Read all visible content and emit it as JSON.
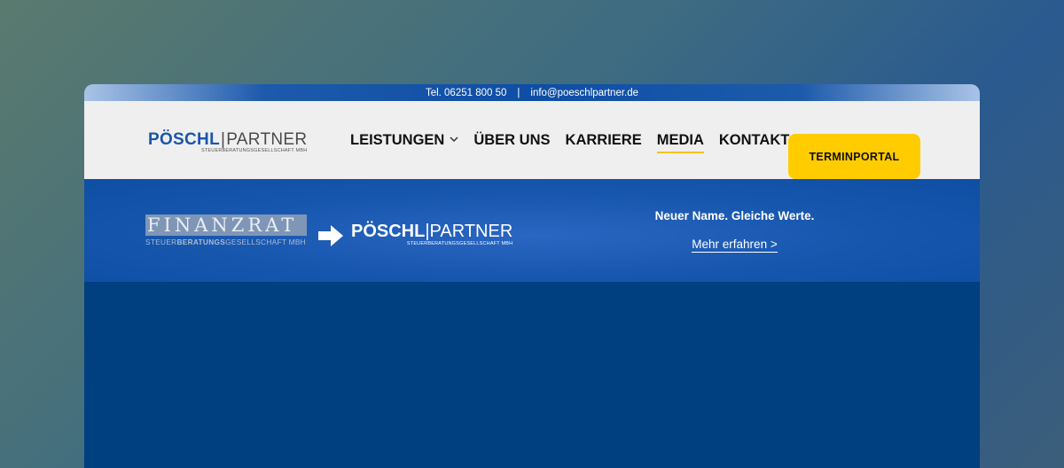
{
  "topbar": {
    "phone": "Tel. 06251 800 50",
    "separator": "|",
    "email": "info@poeschlpartner.de"
  },
  "header": {
    "logo": {
      "brand_bold": "PÖSCHL",
      "bar": "|",
      "brand_light": "PARTNER",
      "subtitle": "STEUERBERATUNGSGESELLSCHAFT MBH"
    },
    "nav": [
      {
        "label": "LEISTUNGEN",
        "has_dropdown": true,
        "active": false
      },
      {
        "label": "ÜBER UNS",
        "active": false
      },
      {
        "label": "KARRIERE",
        "active": false
      },
      {
        "label": "MEDIA",
        "active": true
      },
      {
        "label": "KONTAKT",
        "active": false
      }
    ],
    "cta_label": "TERMINPORTAL"
  },
  "banner": {
    "old_logo": {
      "name": "FINANZRAT",
      "sub_prefix": "STEUER",
      "sub_bold": "BERATUNGS",
      "sub_suffix": "GESELLSCHAFT MBH"
    },
    "arrow_icon": "arrow-right-icon",
    "new_logo": {
      "brand_bold": "PÖSCHL",
      "bar": "|",
      "brand_light": "PARTNER",
      "subtitle": "STEUERBERATUNGSGESELLSCHAFT MBH"
    },
    "headline": "Neuer Name. Gleiche Werte.",
    "link_label": "Mehr erfahren >"
  },
  "colors": {
    "brand_blue": "#1a56a8",
    "banner_blue": "#1656ad",
    "body_blue": "#003f80",
    "accent_yellow": "#ffcc00",
    "header_bg": "#efefef"
  }
}
